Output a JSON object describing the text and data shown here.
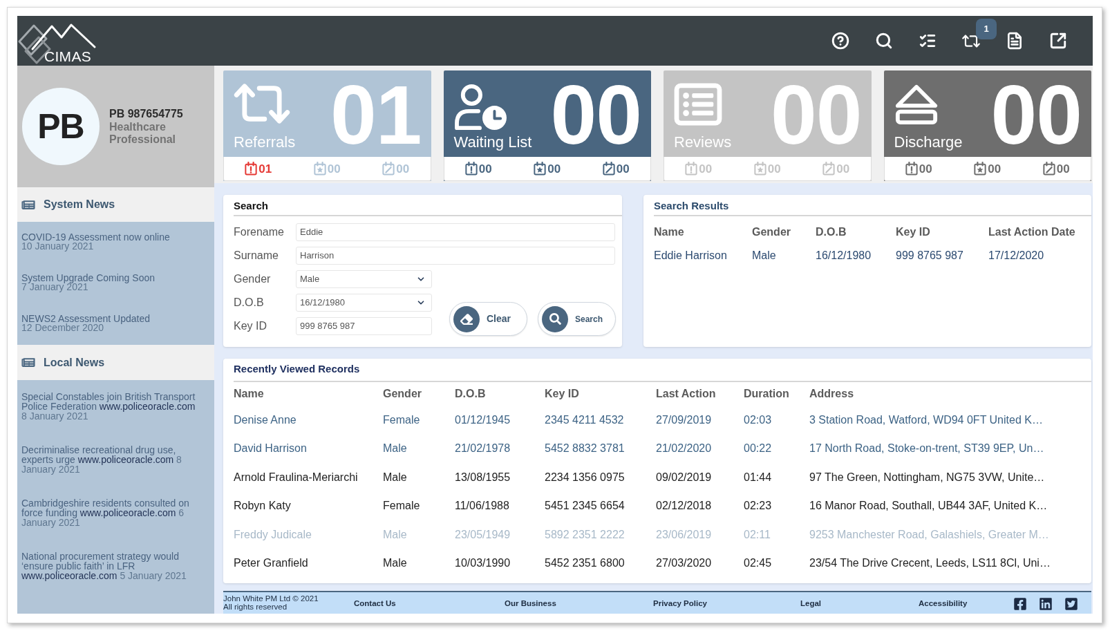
{
  "header": {
    "logo_text": "CIMAS",
    "notification_badge": "1"
  },
  "profile": {
    "initials": "PB",
    "id": "PB 987654775",
    "role": "Healthcare Professional"
  },
  "tiles": [
    {
      "kind": "referrals",
      "label": "Referrals",
      "count": "01",
      "color": "#b0c4d6",
      "stats": [
        {
          "kind": "alert",
          "value": "01",
          "urgent": true
        },
        {
          "kind": "starred",
          "value": "00",
          "urgent": false
        },
        {
          "kind": "edited",
          "value": "00",
          "urgent": false
        }
      ]
    },
    {
      "kind": "waiting",
      "label": "Waiting List",
      "count": "00",
      "color": "#4a6680",
      "stats": [
        {
          "kind": "alert",
          "value": "00",
          "urgent": false
        },
        {
          "kind": "starred",
          "value": "00",
          "urgent": false
        },
        {
          "kind": "edited",
          "value": "00",
          "urgent": false
        }
      ]
    },
    {
      "kind": "reviews",
      "label": "Reviews",
      "count": "00",
      "color": "#c4c4c4",
      "stats": [
        {
          "kind": "alert",
          "value": "00",
          "urgent": false
        },
        {
          "kind": "starred",
          "value": "00",
          "urgent": false
        },
        {
          "kind": "edited",
          "value": "00",
          "urgent": false
        }
      ]
    },
    {
      "kind": "discharge",
      "label": "Discharge",
      "count": "00",
      "color": "#6e6e6e",
      "stats": [
        {
          "kind": "alert",
          "value": "00",
          "urgent": false
        },
        {
          "kind": "starred",
          "value": "00",
          "urgent": false
        },
        {
          "kind": "edited",
          "value": "00",
          "urgent": false
        }
      ]
    }
  ],
  "system_news": {
    "title": "System News",
    "items": [
      {
        "title": "COVID-19 Assessment now online",
        "date": "10 January 2021"
      },
      {
        "title": "System Upgrade Coming Soon",
        "date": "7 January 2021"
      },
      {
        "title": "NEWS2 Assessment Updated",
        "date": "12 December 2020"
      }
    ]
  },
  "local_news": {
    "title": "Local News",
    "items": [
      {
        "title": "Special Constables join British Transport Police Federation",
        "link": "www.policeoracle.com",
        "date": "8 January 2021"
      },
      {
        "title": "Decriminalise recreational drug use, experts urge",
        "link": "www.policeoracle.com",
        "date": "8 January 2021"
      },
      {
        "title": "Cambridgeshire residents consulted on force funding",
        "link": "www.policeoracle.com",
        "date": "6 January 2021"
      },
      {
        "title": "National procurement strategy would ‘ensure public faith’ in LFR",
        "link": "www.policeoracle.com",
        "date": "5 January 2021"
      }
    ]
  },
  "search": {
    "title": "Search",
    "fields": [
      {
        "label": "Forename",
        "value": "Eddie",
        "kind": "wide"
      },
      {
        "label": "Surname",
        "value": "Harrison",
        "kind": "wide"
      },
      {
        "label": "Gender",
        "value": "Male",
        "kind": "select"
      },
      {
        "label": "D.O.B",
        "value": "16/12/1980",
        "kind": "select"
      },
      {
        "label": "Key ID",
        "value": "999 8765 987",
        "kind": "narrow"
      }
    ],
    "buttons": [
      {
        "label": "Clear",
        "kind": "clear"
      },
      {
        "label": "Search",
        "kind": "search"
      }
    ]
  },
  "search_results": {
    "title": "Search Results",
    "columns": [
      "Name",
      "Gender",
      "D.O.B",
      "Key ID",
      "Last Action Date"
    ],
    "rows": [
      [
        "Eddie Harrison",
        "Male",
        "16/12/1980",
        "999 8765 987",
        "17/12/2020"
      ]
    ]
  },
  "recent_records": {
    "title": "Recently Viewed Records",
    "columns": [
      "Name",
      "Gender",
      "D.O.B",
      "Key ID",
      "Last Action",
      "Duration",
      "Address"
    ],
    "rows": [
      {
        "cells": [
          "Denise Anne",
          "Female",
          "01/12/1945",
          "2345 4211 4532",
          "27/09/2019",
          "02:03",
          "3 Station Road, Watford, WD94 0FT United K…"
        ],
        "highlighted": true,
        "disabled": false
      },
      {
        "cells": [
          "David Harrison",
          "Male",
          "21/02/1978",
          "5452 8832 3781",
          "21/02/2020",
          "00:22",
          "17 North Road, Stoke-on-trent, ST39 9EP, Un…"
        ],
        "highlighted": true,
        "disabled": false
      },
      {
        "cells": [
          "Arnold Fraulina-Meriarchi",
          "Male",
          "13/08/1955",
          "2234 1356 0975",
          "09/02/2019",
          "01:44",
          "97 The Green, Nottingham, NG75 3VW, Unite…"
        ],
        "highlighted": false,
        "disabled": false
      },
      {
        "cells": [
          "Robyn Katy",
          "Female",
          "11/06/1988",
          "5451 2345 6654",
          "02/12/2018",
          "02:23",
          "16 Manor Road, Southall, UB44 3AF, United K…"
        ],
        "highlighted": false,
        "disabled": false
      },
      {
        "cells": [
          "Freddy Judicale",
          "Male",
          "23/05/1949",
          "5892 2351 2222",
          "23/06/2019",
          "02:11",
          "9253 Manchester Road, Galashiels, Greater M…"
        ],
        "highlighted": true,
        "disabled": true
      },
      {
        "cells": [
          "Peter Granfield",
          "Male",
          "10/03/1990",
          "5452 2351 6800",
          "27/03/2020",
          "02:45",
          "23/54 The Drive Crecent, Leeds, LS11 8Cl, Uni…"
        ],
        "highlighted": false,
        "disabled": false
      }
    ]
  },
  "footer": {
    "copyright": "John White PM Ltd © 2021",
    "rights": "All rights reserved",
    "links": [
      "Contact Us",
      "Our Business",
      "Privacy Policy",
      "Legal",
      "Accessibility"
    ]
  }
}
